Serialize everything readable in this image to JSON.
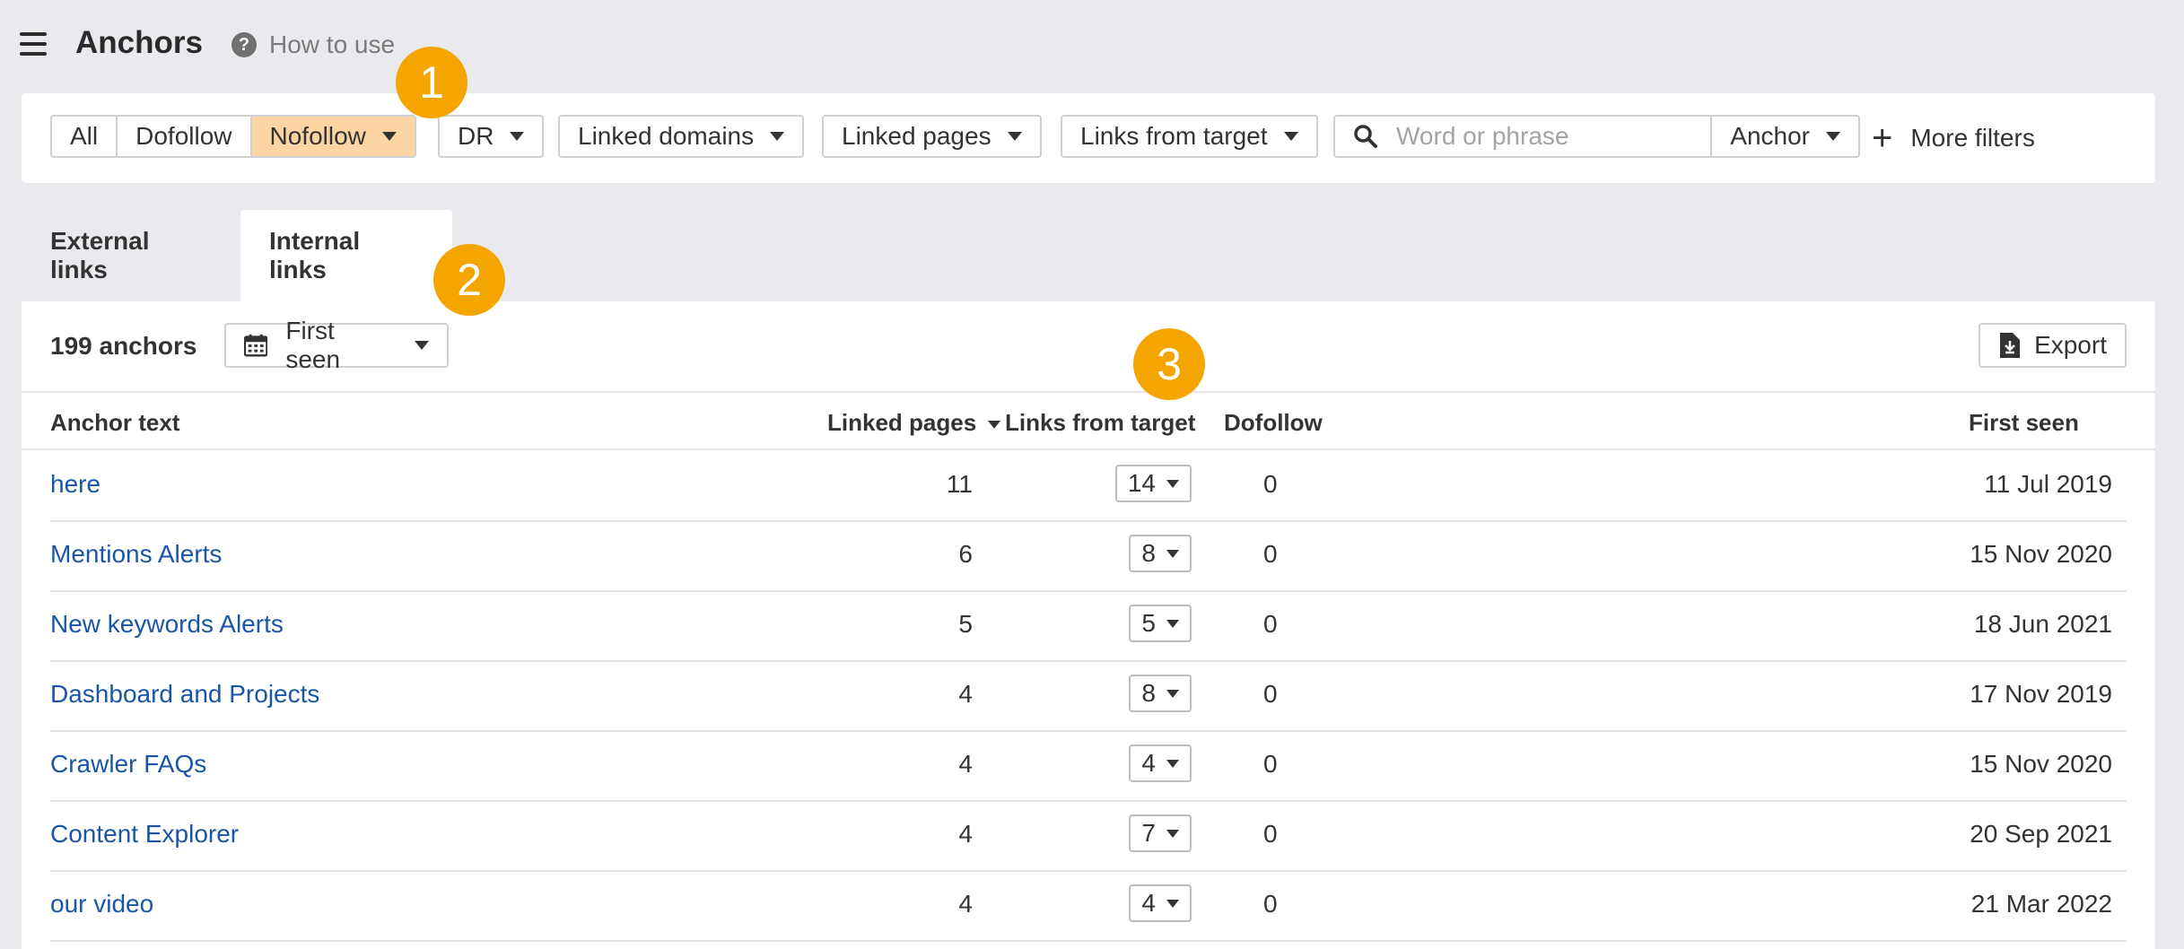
{
  "header": {
    "title": "Anchors",
    "help_label": "How to use"
  },
  "filters": {
    "segment": [
      "All",
      "Dofollow",
      "Nofollow"
    ],
    "segment_active": "Nofollow",
    "dropdowns": [
      "DR",
      "Linked domains",
      "Linked pages",
      "Links from target"
    ],
    "search_placeholder": "Word or phrase",
    "search_mode": "Anchor",
    "more_filters": "More filters"
  },
  "tabs": {
    "external": "External links",
    "internal": "Internal links",
    "active": "Internal links"
  },
  "toolbar": {
    "count": "199 anchors",
    "date_filter": "First seen",
    "export": "Export"
  },
  "table": {
    "columns": [
      "Anchor text",
      "Linked pages",
      "Links from target",
      "Dofollow",
      "First seen"
    ],
    "sort_column": "Linked pages",
    "rows": [
      {
        "anchor": "here",
        "linked_pages": "11",
        "links_from_target": "14",
        "dofollow": "0",
        "first_seen": "11 Jul 2019"
      },
      {
        "anchor": "Mentions Alerts",
        "linked_pages": "6",
        "links_from_target": "8",
        "dofollow": "0",
        "first_seen": "15 Nov 2020"
      },
      {
        "anchor": "New keywords Alerts",
        "linked_pages": "5",
        "links_from_target": "5",
        "dofollow": "0",
        "first_seen": "18 Jun 2021"
      },
      {
        "anchor": "Dashboard and Projects",
        "linked_pages": "4",
        "links_from_target": "8",
        "dofollow": "0",
        "first_seen": "17 Nov 2019"
      },
      {
        "anchor": "Crawler FAQs",
        "linked_pages": "4",
        "links_from_target": "4",
        "dofollow": "0",
        "first_seen": "15 Nov 2020"
      },
      {
        "anchor": "Content Explorer",
        "linked_pages": "4",
        "links_from_target": "7",
        "dofollow": "0",
        "first_seen": "20 Sep 2021"
      },
      {
        "anchor": "our video",
        "linked_pages": "4",
        "links_from_target": "4",
        "dofollow": "0",
        "first_seen": "21 Mar 2022"
      }
    ]
  },
  "badges": [
    "1",
    "2",
    "3"
  ],
  "colors": {
    "accent_badge": "#f5a500",
    "active_filter": "#fdd4a3",
    "link": "#1a56a8"
  }
}
